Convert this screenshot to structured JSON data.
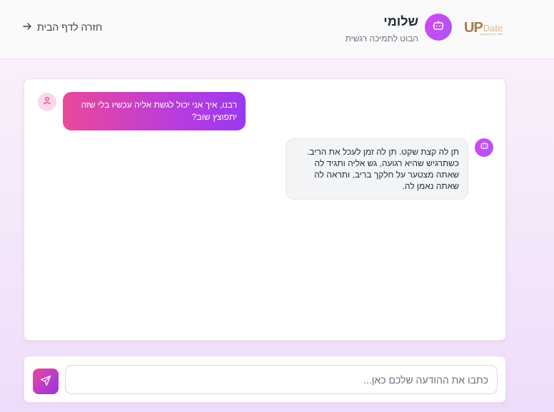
{
  "header": {
    "back_label": "חזרה לדף הבית",
    "bot_name": "שלומי",
    "bot_subtitle": "הבוט לתמיכה רגשית",
    "logo_main": "UP",
    "logo_date": "Date",
    "logo_tagline": "upgrade your date"
  },
  "chat": {
    "messages": [
      {
        "role": "user",
        "text": "רבנו, איך אני יכול לגשת אליה עכשיו בלי שזה יתפוצץ שוב?"
      },
      {
        "role": "bot",
        "text": "תן לה קצת שקט. תן לה זמן לעכל את הריב. כשתרגיש שהיא רגועה, גש אליה ותגיד לה שאתה מצטער על חלקך בריב, ותראה לה שאתה נאמן לה."
      }
    ]
  },
  "composer": {
    "placeholder": "כתבו את ההודעה שלכם כאן...",
    "value": ""
  },
  "colors": {
    "accent_start": "#ec4899",
    "accent_end": "#9333ea",
    "logo_brown": "#a87a4e"
  },
  "icons": {
    "back": "arrow-right-icon",
    "bot": "robot-icon",
    "user": "user-icon",
    "send": "send-icon"
  }
}
